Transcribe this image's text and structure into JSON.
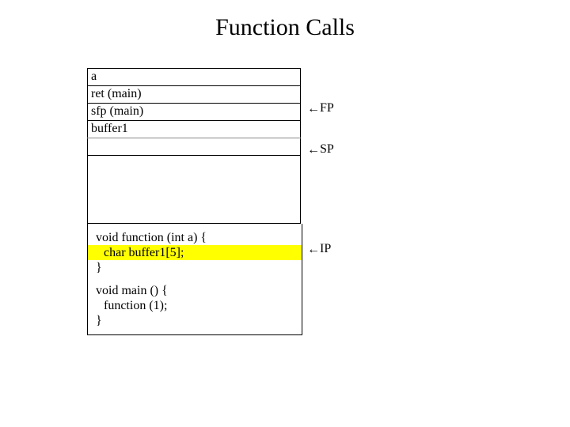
{
  "title": "Function Calls",
  "stack": {
    "row0": "a",
    "row1": "ret (main)",
    "row2": "sfp (main)",
    "row3": "buffer1"
  },
  "pointers": {
    "fp": "FP",
    "sp": "SP",
    "ip": "IP"
  },
  "code": {
    "l1": "void function (int a) {",
    "l2": "char buffer1[5];",
    "l3": "}",
    "l4": "void main () {",
    "l5": "function (1);",
    "l6": "}"
  }
}
